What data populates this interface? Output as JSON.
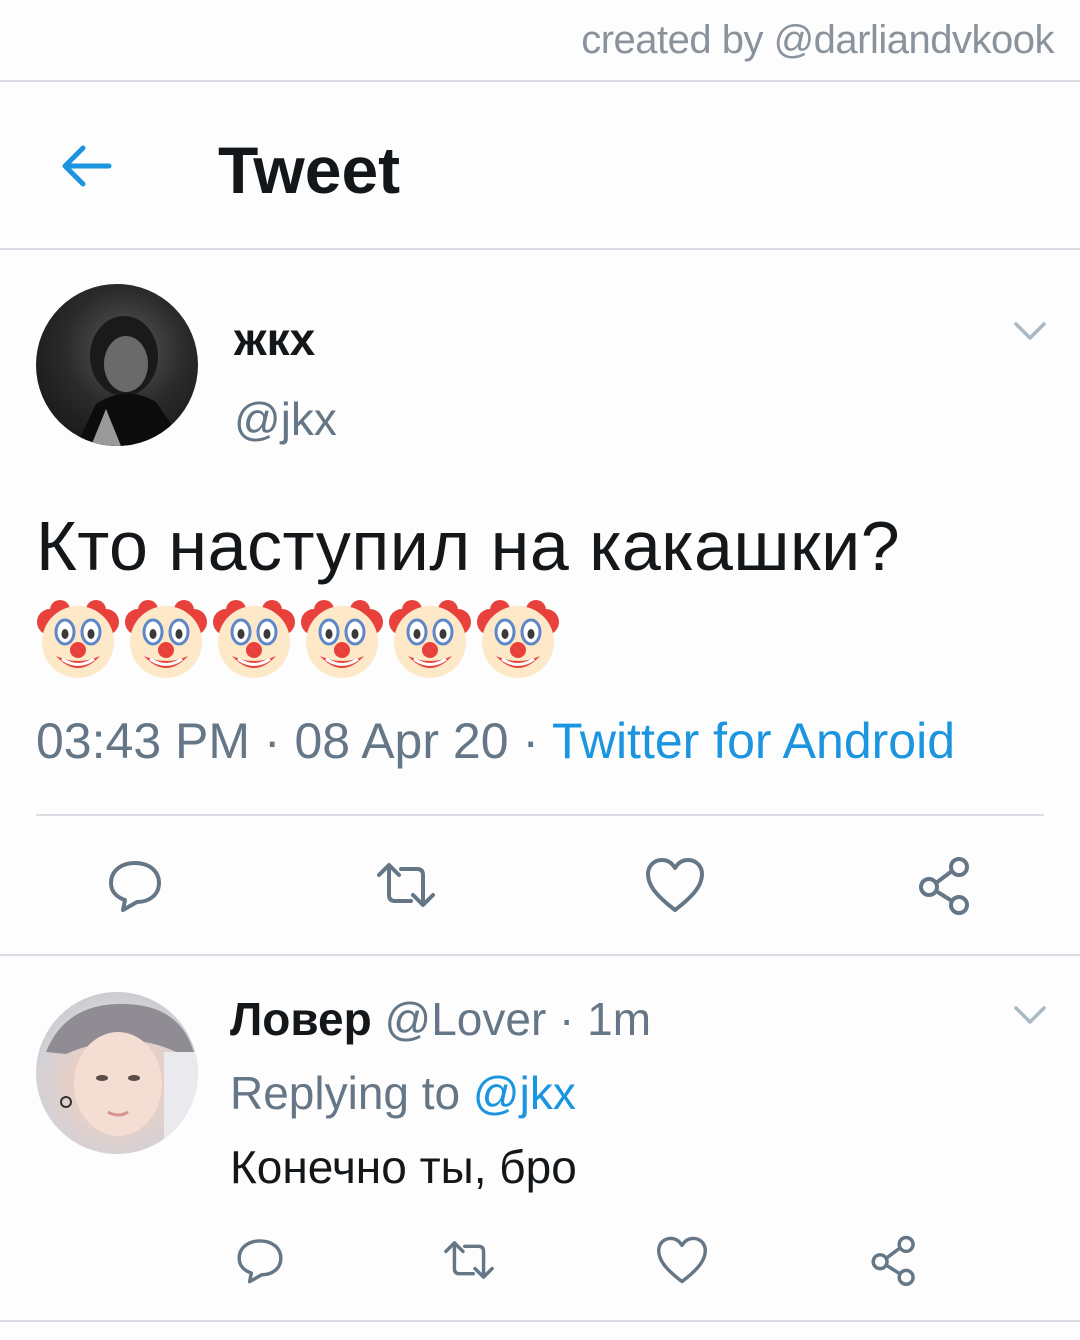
{
  "watermark": "created by @darliandvkook",
  "header": {
    "title": "Tweet",
    "back_icon": "arrow-left-icon",
    "accent_color": "#1b95e0"
  },
  "tweet": {
    "display_name": "жкх",
    "handle": "@jkx",
    "text": "Кто наступил на какашки?",
    "emojis": [
      "clown-face",
      "clown-face",
      "clown-face",
      "clown-face",
      "clown-face",
      "clown-face"
    ],
    "time": "03:43 PM",
    "sep1": " · ",
    "date": "08 Apr 20",
    "sep2": " · ",
    "source": "Twitter for Android",
    "actions": [
      "reply-icon",
      "retweet-icon",
      "like-icon",
      "share-icon"
    ]
  },
  "reply": {
    "display_name": "Ловер",
    "handle": "@Lover",
    "time_sep": " · ",
    "time": "1m",
    "replying_prefix": "Replying to ",
    "replying_to": "@jkx",
    "text": "Конечно ты, бро",
    "actions": [
      "reply-icon",
      "retweet-icon",
      "like-icon",
      "share-icon"
    ]
  }
}
